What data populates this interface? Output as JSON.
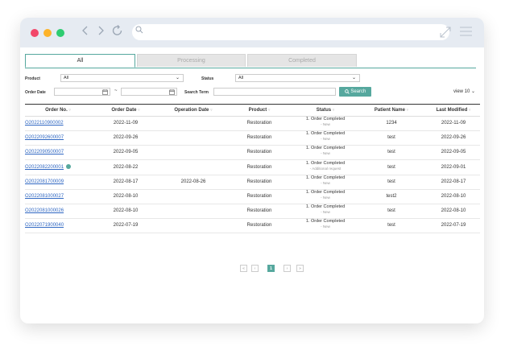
{
  "tabs": [
    "All",
    "Processing",
    "Completed"
  ],
  "filters": {
    "product_label": "Product",
    "product_value": "All",
    "status_label": "Status",
    "status_value": "All",
    "order_date_label": "Order Date",
    "date_sep": "~",
    "search_term_label": "Search Term",
    "search_button": "Search",
    "view_select": "view 10"
  },
  "table": {
    "headers": [
      "Order No.",
      "Order Date",
      "Operation Date",
      "Product",
      "Status",
      "Patient Name",
      "Last Modified"
    ],
    "rows": [
      {
        "order_no": "O2022110900002",
        "order_date": "2022-11-09",
        "operation_date": "",
        "product": "Restoration",
        "status": "1. Order Completed",
        "sub": "- New",
        "patient": "1234",
        "modified": "2022-11-09"
      },
      {
        "order_no": "O2022092600007",
        "order_date": "2022-09-26",
        "operation_date": "",
        "product": "Restoration",
        "status": "1. Order Completed",
        "sub": "- New",
        "patient": "test",
        "modified": "2022-09-26"
      },
      {
        "order_no": "O2022090500007",
        "order_date": "2022-09-05",
        "operation_date": "",
        "product": "Restoration",
        "status": "1. Order Completed",
        "sub": "- New",
        "patient": "test",
        "modified": "2022-09-05"
      },
      {
        "order_no": "O2022082200001",
        "order_date": "2022-08-22",
        "operation_date": "",
        "product": "Restoration",
        "status": "1. Order Completed",
        "sub": "- Additional request",
        "patient": "test",
        "modified": "2022-09-01"
      },
      {
        "order_no": "O2022081700009",
        "order_date": "2022-08-17",
        "operation_date": "2022-08-26",
        "product": "Restoration",
        "status": "1. Order Completed",
        "sub": "- New",
        "patient": "test",
        "modified": "2022-08-17"
      },
      {
        "order_no": "O2022081000027",
        "order_date": "2022-08-10",
        "operation_date": "",
        "product": "Restoration",
        "status": "1. Order Completed",
        "sub": "- New",
        "patient": "test2",
        "modified": "2022-08-10"
      },
      {
        "order_no": "O2022081000026",
        "order_date": "2022-08-10",
        "operation_date": "",
        "product": "Restoration",
        "status": "1. Order Completed",
        "sub": "- New",
        "patient": "test",
        "modified": "2022-08-10"
      },
      {
        "order_no": "O2022071900040",
        "order_date": "2022-07-19",
        "operation_date": "",
        "product": "Restoration",
        "status": "1. Order Completed",
        "sub": "- New",
        "patient": "test",
        "modified": "2022-07-19"
      }
    ]
  },
  "pagination": {
    "first": "«",
    "prev": "‹",
    "current": "1",
    "next": "›",
    "last": "»"
  },
  "colors": {
    "accent": "#56a89e",
    "link": "#2f67c2",
    "dot_red": "#f2476a",
    "dot_yellow": "#fdb32a",
    "dot_green": "#2ecc71"
  }
}
